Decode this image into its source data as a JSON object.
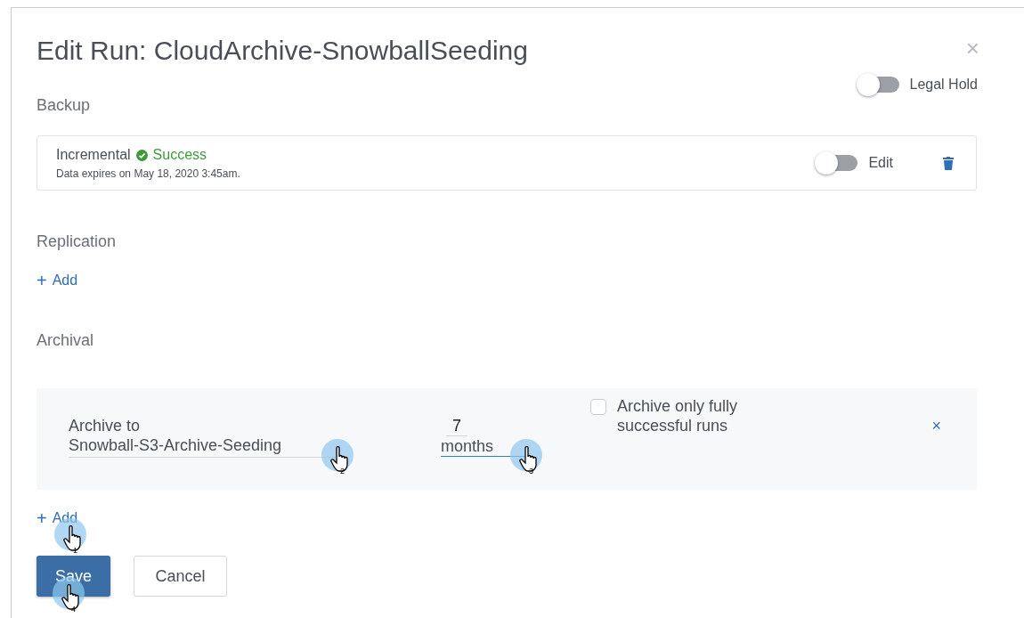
{
  "dialog": {
    "title": "Edit Run: CloudArchive-SnowballSeeding",
    "close": "×"
  },
  "legal_hold": {
    "label": "Legal Hold",
    "on": false
  },
  "backup": {
    "heading": "Backup",
    "type": "Incremental",
    "status": "Success",
    "expires": "Data expires on May 18, 2020 3:45am.",
    "edit": {
      "label": "Edit",
      "on": false
    }
  },
  "replication": {
    "heading": "Replication",
    "add": {
      "plus": "+",
      "label": "Add"
    }
  },
  "archival": {
    "heading": "Archival",
    "target_label": "Archive to",
    "target": "Snowball-S3-Archive-Seeding",
    "target_step": "2",
    "count": "7",
    "unit": "months",
    "unit_step": "3",
    "only_successful": {
      "label": "Archive only fully successful runs",
      "checked": false
    },
    "remove": "×",
    "add": {
      "plus": "+",
      "label": "Add",
      "step": "1"
    }
  },
  "buttons": {
    "save": {
      "label": "Save",
      "step": "4"
    },
    "cancel": {
      "label": "Cancel"
    }
  }
}
